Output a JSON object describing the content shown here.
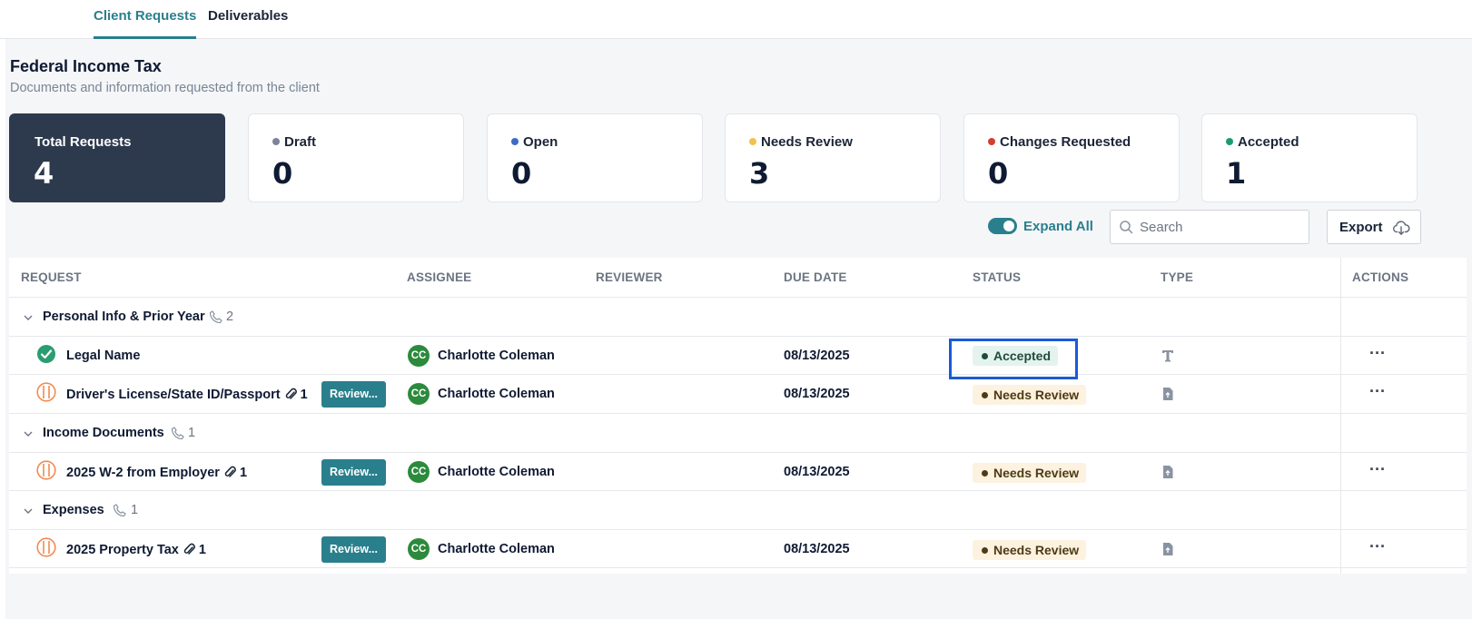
{
  "tabs": [
    {
      "label": "Client Requests",
      "active": true
    },
    {
      "label": "Deliverables",
      "active": false
    }
  ],
  "page": {
    "title": "Federal Income Tax",
    "subtitle": "Documents and information requested from the client"
  },
  "stats": [
    {
      "label": "Total Requests",
      "value": "4",
      "color": ""
    },
    {
      "label": "Draft",
      "value": "0",
      "color": "#7c8496"
    },
    {
      "label": "Open",
      "value": "0",
      "color": "#3d6cc4"
    },
    {
      "label": "Needs Review",
      "value": "3",
      "color": "#f2c14e"
    },
    {
      "label": "Changes Requested",
      "value": "0",
      "color": "#d23f31"
    },
    {
      "label": "Accepted",
      "value": "1",
      "color": "#1f9b74"
    }
  ],
  "toolbar": {
    "expand_all_label": "Expand All",
    "expand_all_on": true,
    "search_placeholder": "Search",
    "search_value": "",
    "export_label": "Export"
  },
  "table": {
    "headers": {
      "request": "REQUEST",
      "assignee": "ASSIGNEE",
      "reviewer": "REVIEWER",
      "due_date": "DUE DATE",
      "status": "STATUS",
      "type": "TYPE",
      "actions": "ACTIONS"
    },
    "groups": [
      {
        "label": "Personal Info & Prior Year",
        "count": "2",
        "items": [
          {
            "name": "Legal Name",
            "attachments": "",
            "review_label": "",
            "avatar": "CC",
            "assignee": "Charlotte Coleman",
            "reviewer": "",
            "due": "08/13/2025",
            "status": "Accepted",
            "type_icon": "text-type-icon"
          },
          {
            "name": "Driver's License/State ID/Passport",
            "attachments": "1",
            "review_label": "Review...",
            "avatar": "CC",
            "assignee": "Charlotte Coleman",
            "reviewer": "",
            "due": "08/13/2025",
            "status": "Needs Review",
            "type_icon": "file-upload-icon"
          }
        ]
      },
      {
        "label": "Income Documents",
        "count": "1",
        "items": [
          {
            "name": "2025 W-2 from Employer",
            "attachments": "1",
            "review_label": "Review...",
            "avatar": "CC",
            "assignee": "Charlotte Coleman",
            "reviewer": "",
            "due": "08/13/2025",
            "status": "Needs Review",
            "type_icon": "file-upload-icon"
          }
        ]
      },
      {
        "label": "Expenses",
        "count": "1",
        "items": [
          {
            "name": "2025 Property Tax",
            "attachments": "1",
            "review_label": "Review...",
            "avatar": "CC",
            "assignee": "Charlotte Coleman",
            "reviewer": "",
            "due": "08/13/2025",
            "status": "Needs Review",
            "type_icon": "file-upload-icon"
          }
        ]
      }
    ]
  },
  "colors": {
    "accent": "#2a7f8c",
    "dark_card": "#2d3a4d",
    "avatar": "#2c8a3c",
    "highlight": "#1a5ad6"
  }
}
